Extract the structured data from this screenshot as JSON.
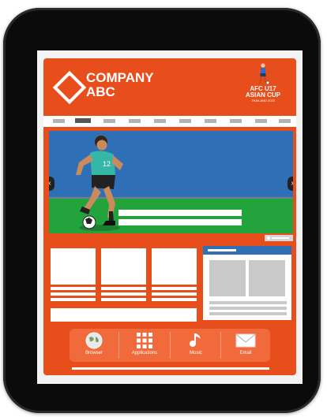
{
  "company": {
    "line1": "COMPANY",
    "line2": "ABC"
  },
  "badge": {
    "line1": "AFC U17",
    "line2": "ASIAN CUP",
    "line3": "THAILAND 2023"
  },
  "slider": {
    "player_number": "12",
    "prev_icon": "chevron-left-icon",
    "next_icon": "chevron-right-icon"
  },
  "dock": [
    {
      "label": "Browser",
      "icon": "globe-icon"
    },
    {
      "label": "Applications",
      "icon": "grid-icon"
    },
    {
      "label": "Music",
      "icon": "music-note-icon"
    },
    {
      "label": "Email",
      "icon": "envelope-icon"
    }
  ],
  "colors": {
    "primary": "#e84e1b",
    "accent": "#2f6fb6",
    "field": "#22a33b"
  }
}
